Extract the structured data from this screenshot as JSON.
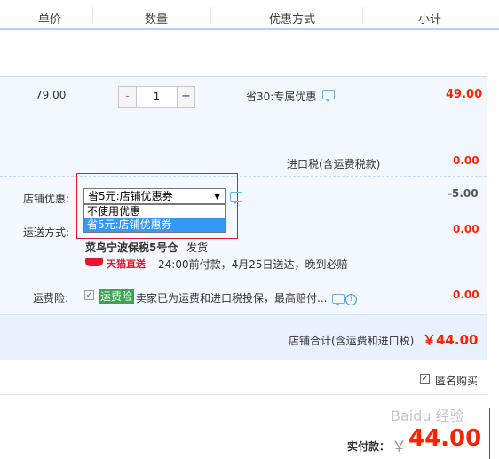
{
  "header": {
    "col_price": "单价",
    "col_qty": "数量",
    "col_promo": "优惠方式",
    "col_subtotal": "小计"
  },
  "item": {
    "price": "79.00",
    "qty_minus": "-",
    "qty_value": "1",
    "qty_plus": "+",
    "promo": "省30:专属优惠",
    "subtotal": "49.00"
  },
  "import_tax": {
    "label": "进口税(含运费税款)",
    "value": "0.00"
  },
  "shop_discount": {
    "label": "店铺优惠:",
    "selected": "省5元:店铺优惠券",
    "options": [
      "不使用优惠",
      "省5元:店铺优惠券"
    ],
    "value": "-5.00"
  },
  "shipping": {
    "label": "运送方式:",
    "value": "0.00",
    "warehouse": "菜鸟宁波保税5号仓",
    "ship_from": "发货",
    "tmall_label": "天猫直送",
    "delivery_note": "24:00前付款，4月25日送达，晚到必赔"
  },
  "freight_insurance": {
    "label": "运费险:",
    "badge": "运费险",
    "desc": "卖家已为运费和进口税投保，最高赔付...",
    "value": "0.00"
  },
  "shop_total": {
    "label": "店铺合计(含运费和进口税)",
    "value": "￥44.00"
  },
  "anonymous": {
    "label": "匿名购买"
  },
  "payment": {
    "label": "实付款：",
    "currency": "￥",
    "value": "44.00"
  },
  "watermark": {
    "text": "Baidu 经验"
  },
  "colors": {
    "accent_red": "#ff2200",
    "border_blue": "#b2d1ff",
    "highlight_blue": "#3399ff"
  }
}
